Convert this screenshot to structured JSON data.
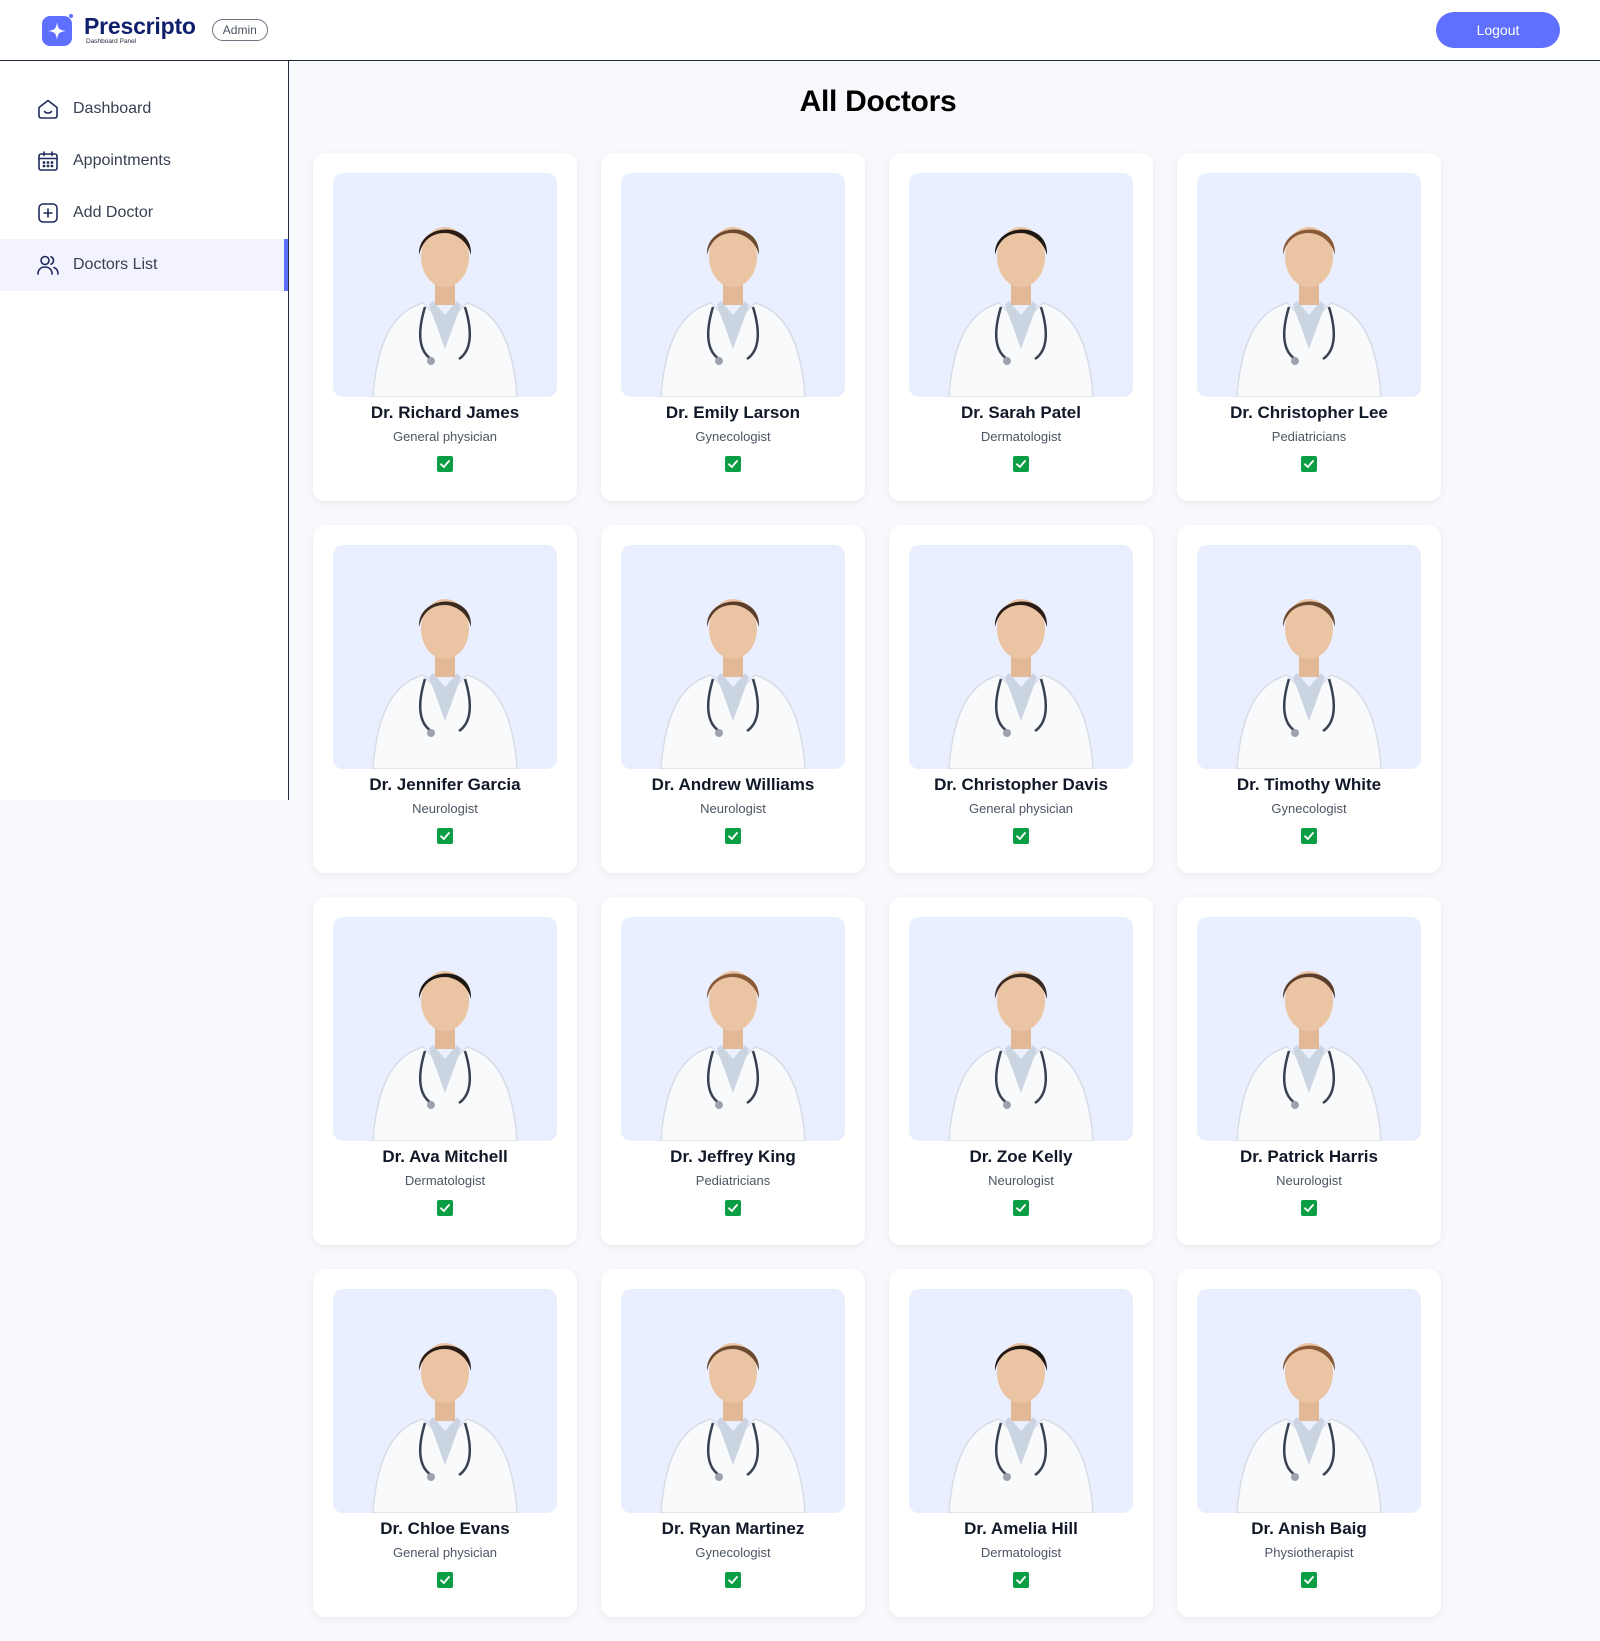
{
  "header": {
    "brand_name": "Prescripto",
    "brand_sub": "Dashboard Panel",
    "role_badge": "Admin",
    "logout_label": "Logout"
  },
  "sidebar": {
    "items": [
      {
        "label": "Dashboard",
        "icon": "home-icon"
      },
      {
        "label": "Appointments",
        "icon": "calendar-icon"
      },
      {
        "label": "Add Doctor",
        "icon": "add-square-icon"
      },
      {
        "label": "Doctors List",
        "icon": "people-icon",
        "active": true
      }
    ]
  },
  "main": {
    "title": "All Doctors",
    "doctors": [
      {
        "name": "Dr. Richard James",
        "speciality": "General physician",
        "available": true
      },
      {
        "name": "Dr. Emily Larson",
        "speciality": "Gynecologist",
        "available": true
      },
      {
        "name": "Dr. Sarah Patel",
        "speciality": "Dermatologist",
        "available": true
      },
      {
        "name": "Dr. Christopher Lee",
        "speciality": "Pediatricians",
        "available": true
      },
      {
        "name": "Dr. Jennifer Garcia",
        "speciality": "Neurologist",
        "available": true
      },
      {
        "name": "Dr. Andrew Williams",
        "speciality": "Neurologist",
        "available": true
      },
      {
        "name": "Dr. Christopher Davis",
        "speciality": "General physician",
        "available": true
      },
      {
        "name": "Dr. Timothy White",
        "speciality": "Gynecologist",
        "available": true
      },
      {
        "name": "Dr. Ava Mitchell",
        "speciality": "Dermatologist",
        "available": true
      },
      {
        "name": "Dr. Jeffrey King",
        "speciality": "Pediatricians",
        "available": true
      },
      {
        "name": "Dr. Zoe Kelly",
        "speciality": "Neurologist",
        "available": true
      },
      {
        "name": "Dr. Patrick Harris",
        "speciality": "Neurologist",
        "available": true
      },
      {
        "name": "Dr. Chloe Evans",
        "speciality": "General physician",
        "available": true
      },
      {
        "name": "Dr. Ryan Martinez",
        "speciality": "Gynecologist",
        "available": true
      },
      {
        "name": "Dr. Amelia Hill",
        "speciality": "Dermatologist",
        "available": true
      },
      {
        "name": "Dr. Anish Baig",
        "speciality": "Physiotherapist",
        "available": true
      }
    ]
  },
  "colors": {
    "primary": "#5f6FFF",
    "photo_bg": "#EAEFFF",
    "page_bg": "#F8F9FD",
    "active_nav_bg": "#F2F3FF",
    "checkbox": "#0b9d43"
  }
}
